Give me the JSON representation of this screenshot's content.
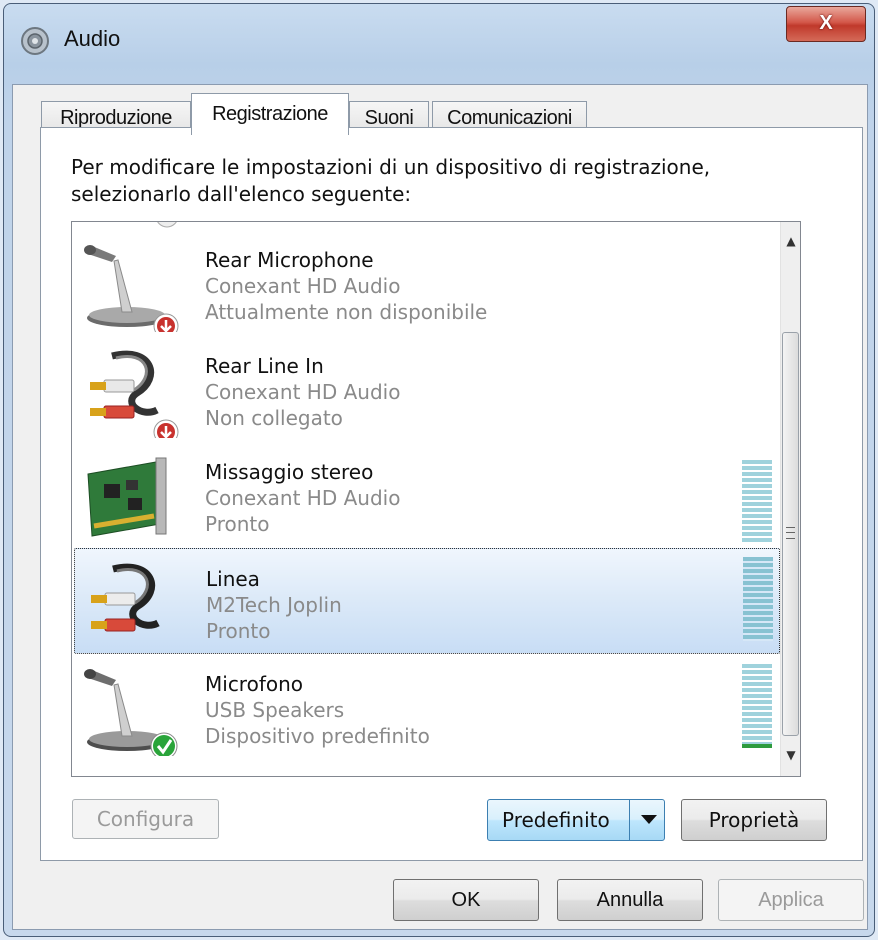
{
  "window": {
    "title": "Audio",
    "close_label": "X"
  },
  "tabs": [
    {
      "label": "Riproduzione"
    },
    {
      "label": "Registrazione"
    },
    {
      "label": "Suoni"
    },
    {
      "label": "Comunicazioni"
    }
  ],
  "instructions": "Per modificare le impostazioni di un dispositivo di registrazione, selezionarlo dall'elenco seguente:",
  "devices": [
    {
      "name": "Rear Microphone",
      "driver": "Conexant HD Audio",
      "status": "Attualmente non disponibile",
      "icon": "microphone-icon",
      "badge": "red-down-arrow",
      "level": 0
    },
    {
      "name": "Rear Line In",
      "driver": "Conexant HD Audio",
      "status": "Non collegato",
      "icon": "line-in-cable-icon",
      "badge": "red-down-arrow",
      "level": 0
    },
    {
      "name": "Missaggio stereo",
      "driver": "Conexant HD Audio",
      "status": "Pronto",
      "icon": "sound-card-icon",
      "level": 0
    },
    {
      "name": "Linea",
      "driver": "M2Tech Joplin",
      "status": "Pronto",
      "icon": "line-in-cable-icon",
      "selected": true,
      "level": 0
    },
    {
      "name": "Microfono",
      "driver": "USB Speakers",
      "status": "Dispositivo predefinito",
      "icon": "microphone-icon",
      "badge": "green-check",
      "default": true,
      "level": 0.05
    }
  ],
  "buttons": {
    "configure": "Configura",
    "set_default": "Predefinito",
    "properties": "Proprietà",
    "ok": "OK",
    "cancel": "Annulla",
    "apply": "Applica"
  },
  "colors": {
    "selection": "#cde0f6",
    "meter": "#9fd2dc",
    "meter_active": "#2e9b3e",
    "badge_red": "#c8322e",
    "badge_green": "#2aa43a"
  }
}
